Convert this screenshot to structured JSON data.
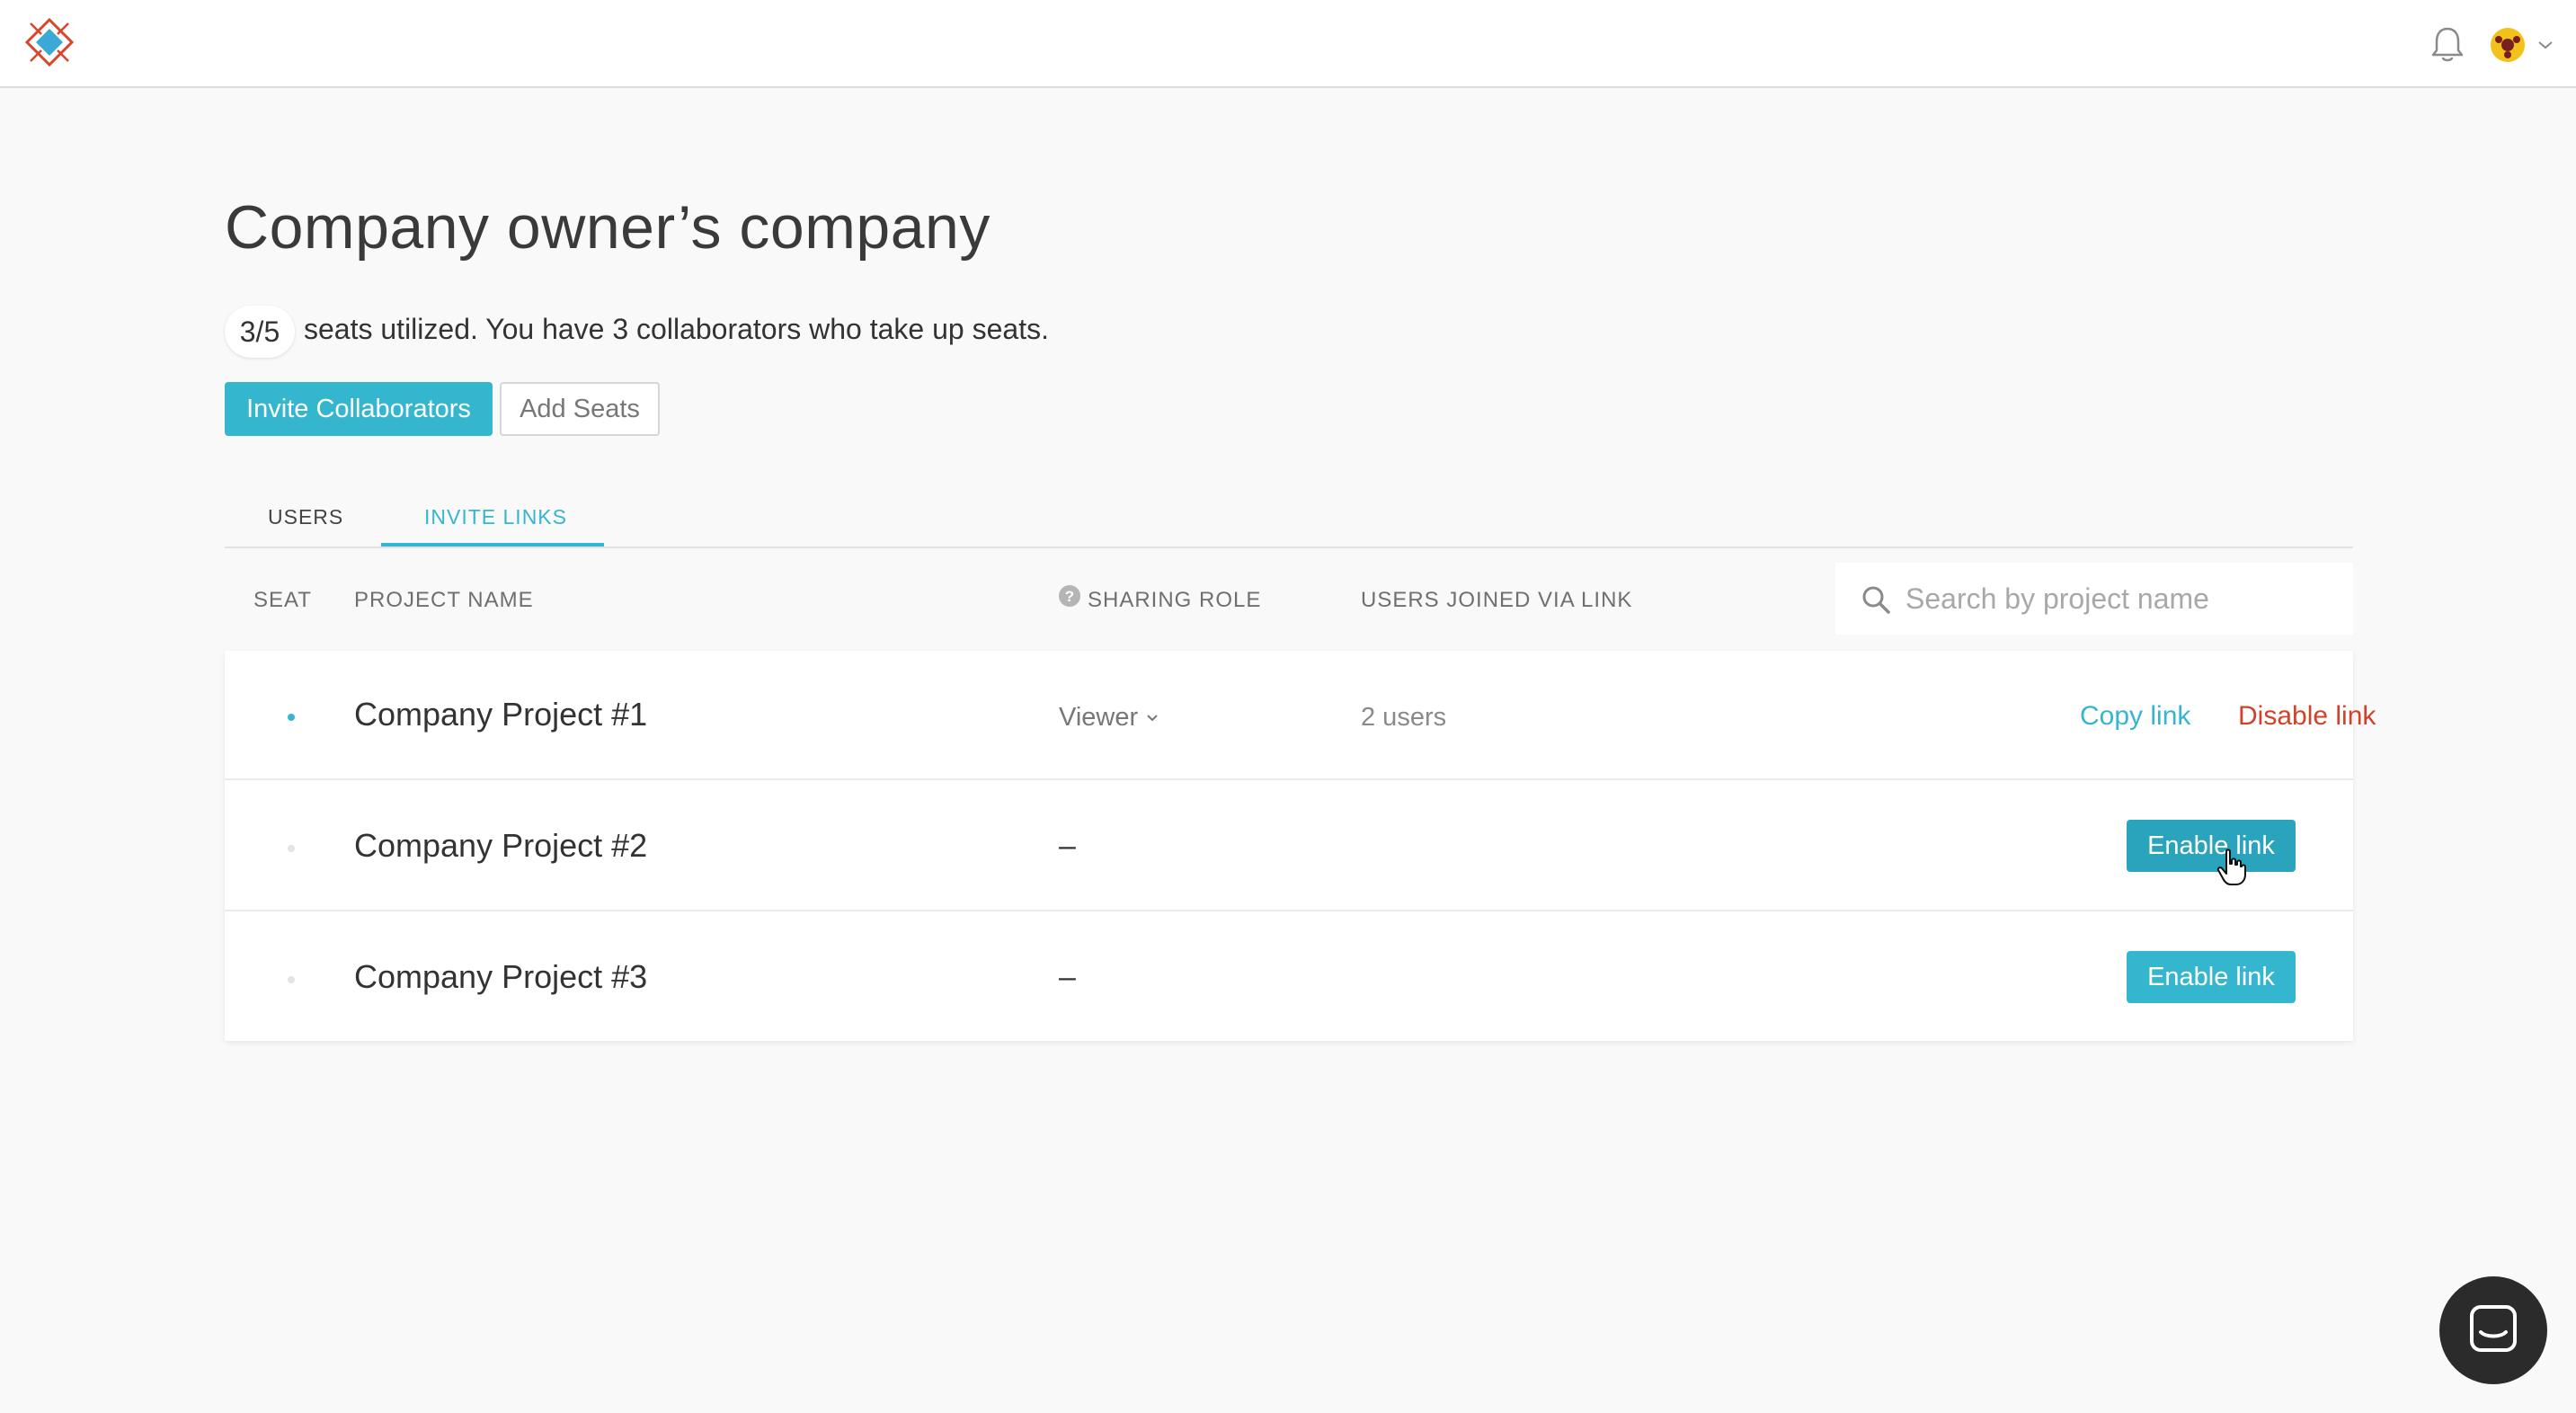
{
  "header": {
    "logo_icon": "diamond-logo-icon",
    "notification_icon": "bell-icon",
    "avatar_icon": "user-avatar-icon",
    "avatar_menu_icon": "chevron-down-icon"
  },
  "page": {
    "title": "Company owner’s company",
    "seats_used": "3/5",
    "seats_text": "seats utilized. You have 3 collaborators who take up seats.",
    "invite_button": "Invite Collaborators",
    "add_seats_button": "Add Seats"
  },
  "tabs": [
    {
      "label": "USERS",
      "active": false
    },
    {
      "label": "INVITE LINKS",
      "active": true
    }
  ],
  "table": {
    "headers": {
      "seat": "SEAT",
      "project": "PROJECT NAME",
      "role": "SHARING ROLE",
      "joined": "USERS JOINED VIA LINK"
    },
    "search_placeholder": "Search by project name",
    "rows": [
      {
        "project": "Company Project #1",
        "seat_active": true,
        "role": "Viewer",
        "users_joined": "2 users",
        "copy_link": "Copy link",
        "disable_link": "Disable link"
      },
      {
        "project": "Company Project #2",
        "seat_active": false,
        "role": "–",
        "enable_link": "Enable link"
      },
      {
        "project": "Company Project #3",
        "seat_active": false,
        "role": "–",
        "enable_link": "Enable link"
      }
    ]
  },
  "colors": {
    "accent": "#35b6cf",
    "danger": "#d0432a",
    "background": "#f9f9f9"
  },
  "chat": {
    "icon": "chat-bubble-icon"
  }
}
